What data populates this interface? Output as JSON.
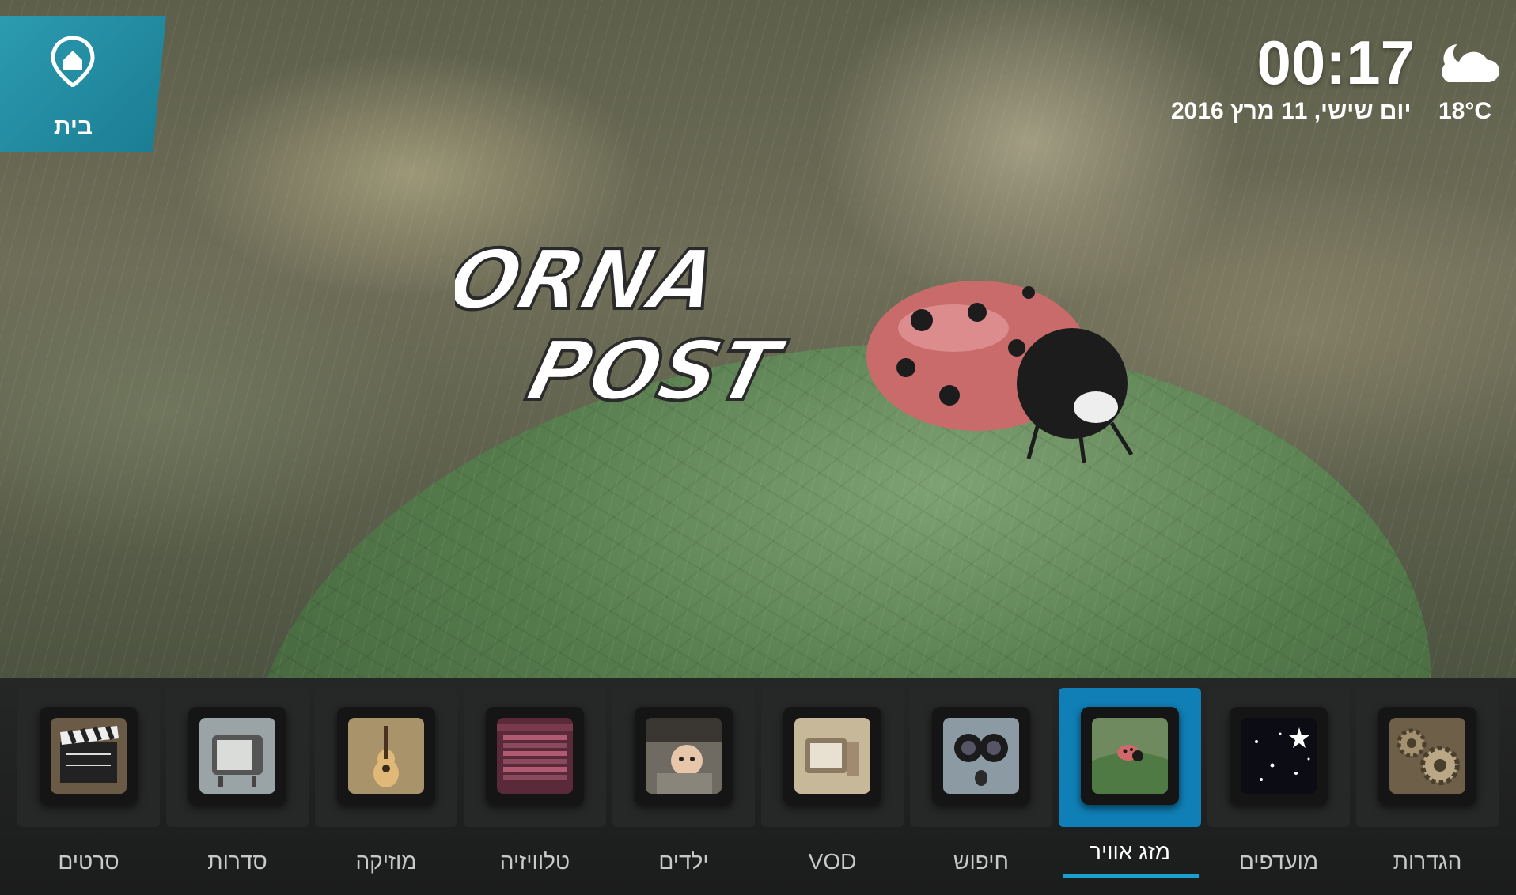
{
  "header": {
    "home_label": "בית",
    "clock": "00:17",
    "date": "יום שישי, 11 מרץ 2016",
    "temperature": "18°C",
    "weather_icon": "partly-cloudy-night-icon",
    "accent_color": "#1aa0cf"
  },
  "menu": {
    "items": [
      {
        "label": "סרטים",
        "icon": "clapperboard-icon"
      },
      {
        "label": "סדרות",
        "icon": "tv-set-icon"
      },
      {
        "label": "מוזיקה",
        "icon": "guitar-icon"
      },
      {
        "label": "טלוויזיה",
        "icon": "tv-guide-icon"
      },
      {
        "label": "ילדים",
        "icon": "child-icon"
      },
      {
        "label": "VOD",
        "icon": "vod-tv-icon"
      },
      {
        "label": "חיפוש",
        "icon": "binoculars-icon"
      },
      {
        "label": "מזג אוויר",
        "icon": "ladybug-icon",
        "selected": true
      },
      {
        "label": "מועדפים",
        "icon": "stars-icon"
      },
      {
        "label": "הגדרות",
        "icon": "gears-icon"
      }
    ]
  }
}
